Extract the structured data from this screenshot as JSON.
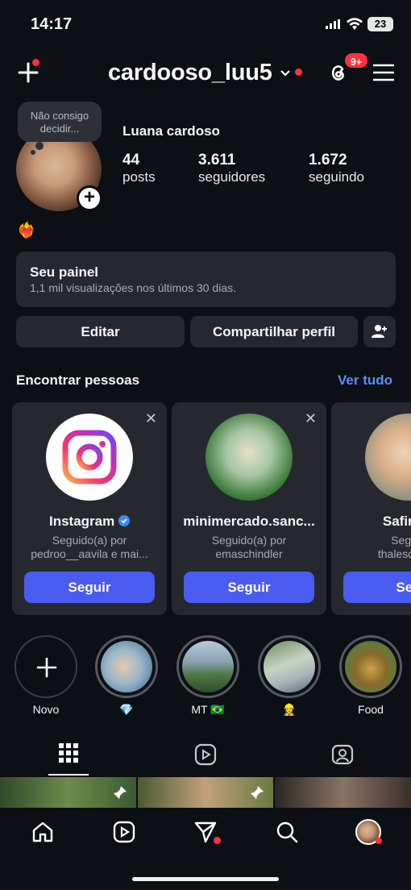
{
  "status_bar": {
    "time": "14:17",
    "battery": "23"
  },
  "header": {
    "username": "cardooso_luu5",
    "notifications_badge": "9+"
  },
  "profile": {
    "note_tooltip": "Não consigo decidir...",
    "full_name": "Luana cardoso",
    "bio_emoji": "❤️‍🔥",
    "stats": [
      {
        "value": "44",
        "label": "posts"
      },
      {
        "value": "3.611",
        "label": "seguidores"
      },
      {
        "value": "1.672",
        "label": "seguindo"
      }
    ]
  },
  "dashboard": {
    "title": "Seu painel",
    "subtitle": "1,1 mil visualizações nos últimos 30 dias."
  },
  "actions": {
    "edit": "Editar",
    "share": "Compartilhar perfil"
  },
  "discover": {
    "title": "Encontrar pessoas",
    "see_all": "Ver tudo",
    "cards": [
      {
        "name": "Instagram",
        "line1": "Seguido(a) por",
        "line2": "pedroo__aavila e mai...",
        "button": "Seguir",
        "verified": true
      },
      {
        "name": "minimercado.sanc...",
        "line1": "Seguido(a) por",
        "line2": "emaschindler",
        "button": "Seguir"
      },
      {
        "name": "Safira B",
        "line1": "Seguid",
        "line2": "thalesqueiro",
        "button": "Seg"
      }
    ]
  },
  "highlights": [
    {
      "label": "Novo"
    },
    {
      "label": "💎"
    },
    {
      "label": "MT 🇧🇷"
    },
    {
      "label": "👷‍♀️"
    },
    {
      "label": "Food"
    }
  ],
  "colors": {
    "accent": "#5c8dfa",
    "follow_button": "#4a5cf0",
    "notification": "#ff3040",
    "background": "#0c0f14",
    "surface": "#25292f"
  }
}
